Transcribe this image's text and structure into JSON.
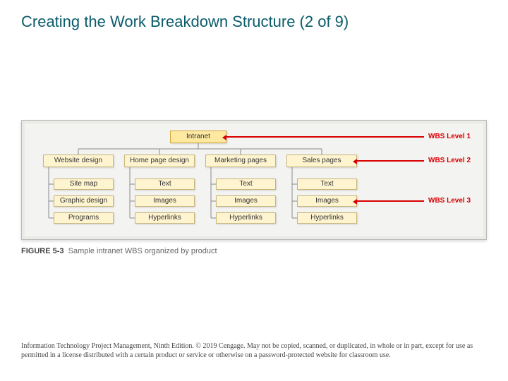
{
  "title": "Creating the Work Breakdown Structure (2 of 9)",
  "figure": {
    "number_label": "FIGURE 5-3",
    "caption": "Sample intranet WBS organized by product",
    "levels": {
      "l1": "WBS Level 1",
      "l2": "WBS Level 2",
      "l3": "WBS Level 3"
    },
    "root": "Intranet",
    "branches": [
      {
        "head": "Website design",
        "children": [
          "Site map",
          "Graphic design",
          "Programs"
        ]
      },
      {
        "head": "Home page design",
        "children": [
          "Text",
          "Images",
          "Hyperlinks"
        ]
      },
      {
        "head": "Marketing pages",
        "children": [
          "Text",
          "Images",
          "Hyperlinks"
        ]
      },
      {
        "head": "Sales pages",
        "children": [
          "Text",
          "Images",
          "Hyperlinks"
        ]
      }
    ]
  },
  "footer": "Information Technology Project Management, Ninth Edition. © 2019 Cengage. May not be copied, scanned, or duplicated, in whole or in part, except for use as permitted in a license distributed with a certain product or service or otherwise on a password-protected website for classroom use."
}
